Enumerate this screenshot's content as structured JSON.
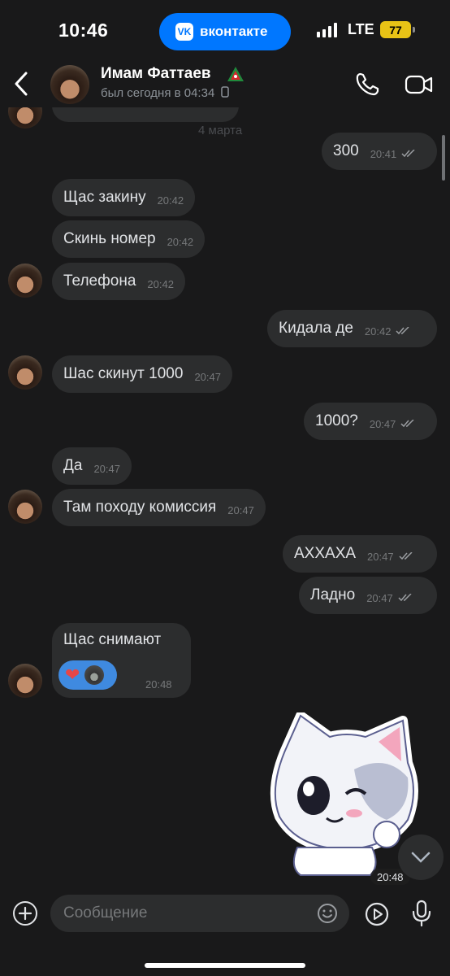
{
  "status_bar": {
    "time": "10:46",
    "app_pill": "вконтакте",
    "vk_logo": "VK",
    "network": "LTE",
    "battery": "77"
  },
  "header": {
    "name": "Имам Фаттаев",
    "last_seen": "был сегодня в 04:34"
  },
  "chat": {
    "date_separator": "4 марта",
    "messages": [
      {
        "text": "300",
        "time": "20:41",
        "dir": "out"
      },
      {
        "text": "Щас закину",
        "time": "20:42",
        "dir": "in"
      },
      {
        "text": "Скинь номер",
        "time": "20:42",
        "dir": "in"
      },
      {
        "text": "Телефона",
        "time": "20:42",
        "dir": "in"
      },
      {
        "text": "Кидала де",
        "time": "20:42",
        "dir": "out"
      },
      {
        "text": "Шас скинут 1000",
        "time": "20:47",
        "dir": "in"
      },
      {
        "text": "1000?",
        "time": "20:47",
        "dir": "out"
      },
      {
        "text": "Да",
        "time": "20:47",
        "dir": "in"
      },
      {
        "text": "Там походу комиссия",
        "time": "20:47",
        "dir": "in"
      },
      {
        "text": "АХХАХА",
        "time": "20:47",
        "dir": "out"
      },
      {
        "text": "Ладно",
        "time": "20:47",
        "dir": "out"
      },
      {
        "text": "Щас снимают",
        "time": "20:48",
        "dir": "in"
      }
    ],
    "reaction": "❤",
    "sticker_time": "20:48"
  },
  "composer": {
    "placeholder": "Сообщение"
  },
  "colors": {
    "background": "#19191a",
    "bubble": "#2c2d2e",
    "accent": "#0077ff",
    "reaction_bg": "#3f8ae0",
    "battery": "#e8c316"
  },
  "icons": [
    "back-arrow-icon",
    "phone-icon",
    "video-camera-icon",
    "plus-icon",
    "smile-icon",
    "play-icon",
    "microphone-icon",
    "chevron-down-icon",
    "double-check-icon",
    "heart-icon"
  ]
}
